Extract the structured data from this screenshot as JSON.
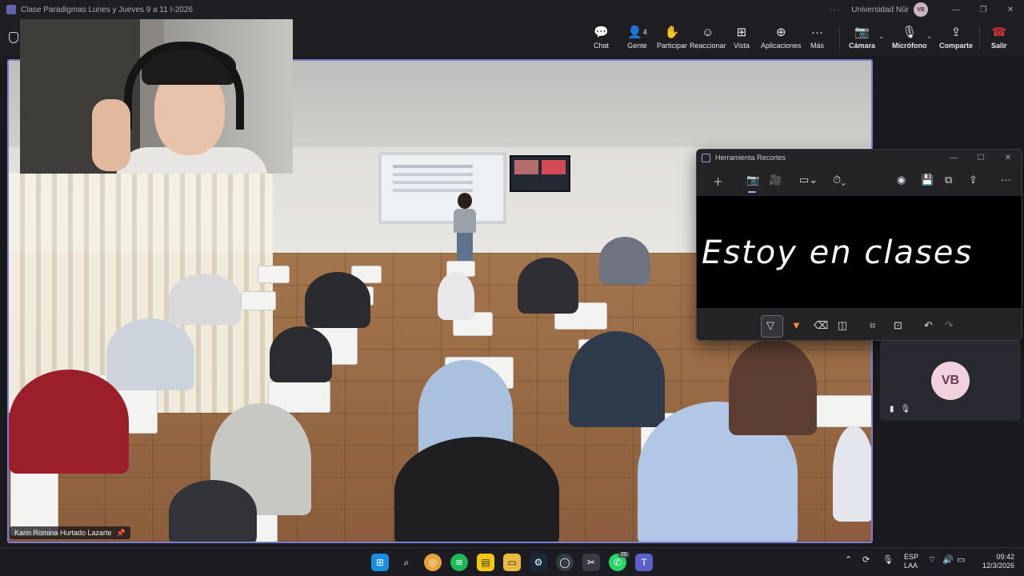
{
  "window": {
    "title": "Clase Paradigmas Lunes y Jueves 9 a 11 I-2026",
    "org": "Universidad Nûr",
    "user_initials": "VB",
    "ellipsis": "···",
    "minimize": "—",
    "restore": "❐",
    "close": "✕"
  },
  "toolbar": {
    "chat": "Chat",
    "people": "Gente",
    "people_count": "4",
    "raise": "Participar",
    "react": "Reaccionar",
    "view": "Vista",
    "apps": "Aplicaciones",
    "more": "Más",
    "camera": "Cámara",
    "mic": "Micrófono",
    "share": "Comparte",
    "leave": "Salir",
    "icons": {
      "chat": "chat-icon",
      "people": "people-icon",
      "raise": "hand-icon",
      "react": "smiley-icon",
      "view": "grid-icon",
      "apps": "plus-icon",
      "more": "ellipsis-icon",
      "camera": "camera-off-icon",
      "mic": "mic-off-icon",
      "share": "share-icon",
      "leave": "phone-hangup-icon"
    },
    "leave_color": "#d13438"
  },
  "stage": {
    "presenter_name": "Karin Romina Hurtado Lazarte"
  },
  "snipping_tool": {
    "title": "Herramienta Recortes",
    "canvas_text": "Estoy en clases",
    "accent": "#a7a9ff"
  },
  "tile": {
    "initials": "VB",
    "avatar_color": "#f1d1de"
  },
  "taskbar": {
    "lang_line1": "ESP",
    "lang_line2": "LAA",
    "time": "09:42",
    "date": "12/3/2026",
    "whatsapp_badge": "20"
  }
}
